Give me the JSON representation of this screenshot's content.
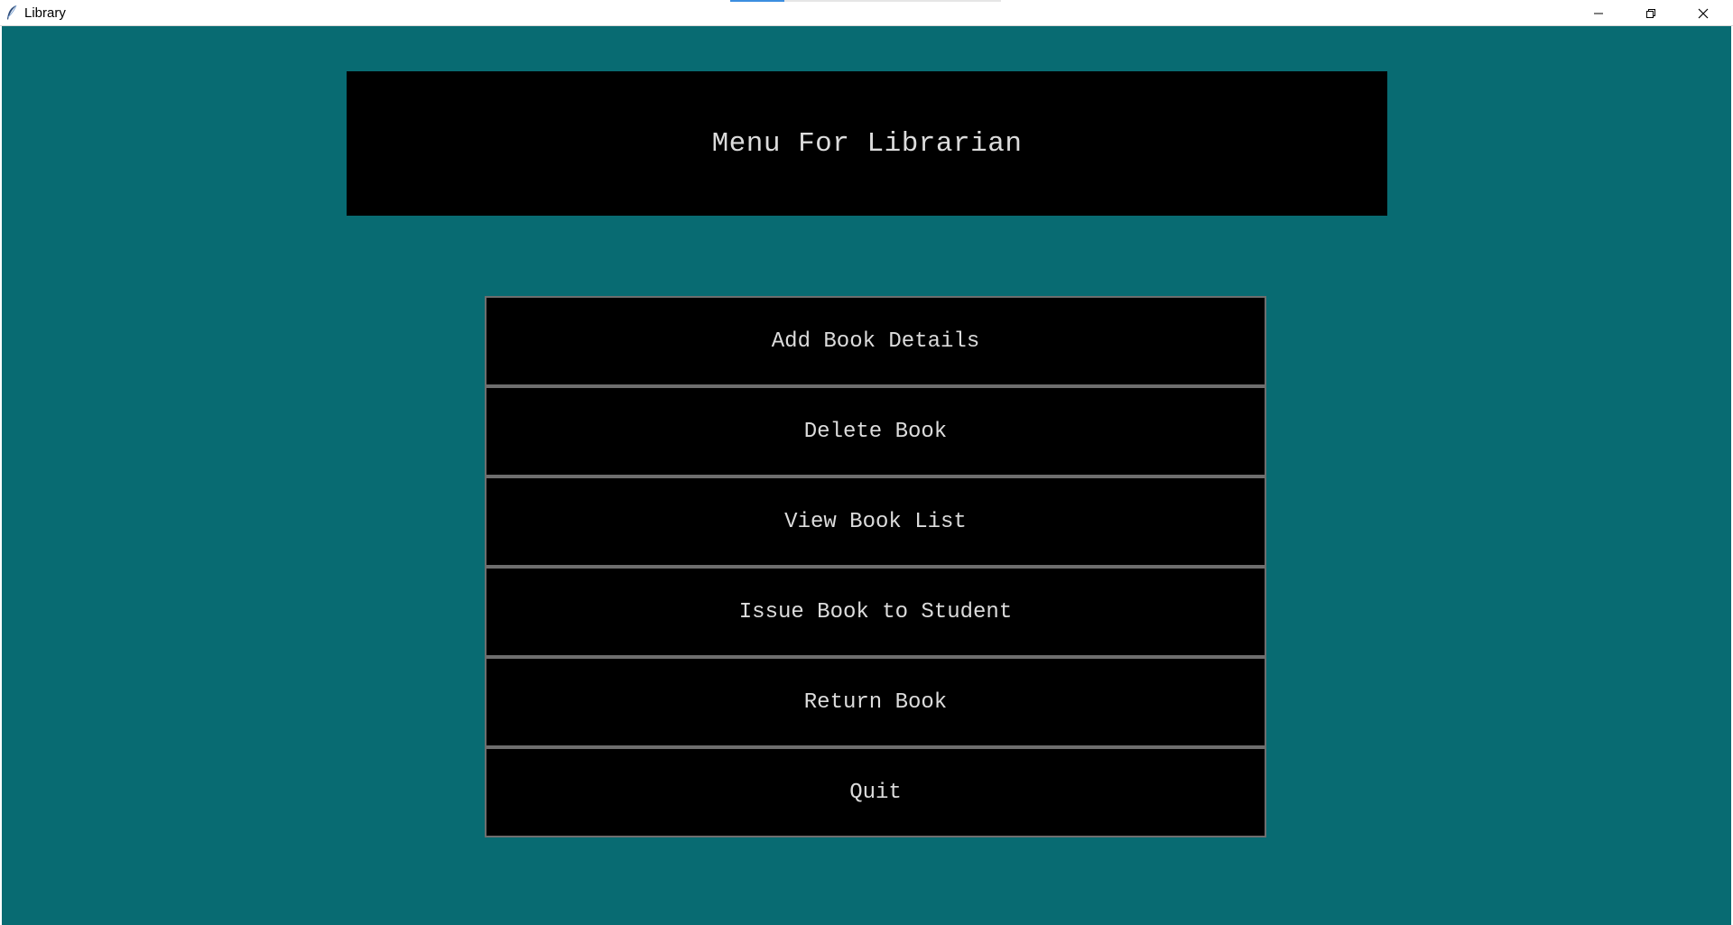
{
  "window": {
    "title": "Library",
    "icon": "feather-icon",
    "controls": [
      "minimize-icon",
      "restore-icon",
      "close-icon"
    ]
  },
  "colors": {
    "background": "#086b72",
    "panel": "#000000",
    "text": "#dcdcdc",
    "button_border": "#6e6e6e"
  },
  "header": {
    "title": "Menu For Librarian"
  },
  "menu": {
    "add_book": "Add Book Details",
    "delete_book": "Delete Book",
    "view_list": "View Book List",
    "issue_book": "Issue Book to Student",
    "return_book": "Return Book",
    "quit": "Quit"
  }
}
